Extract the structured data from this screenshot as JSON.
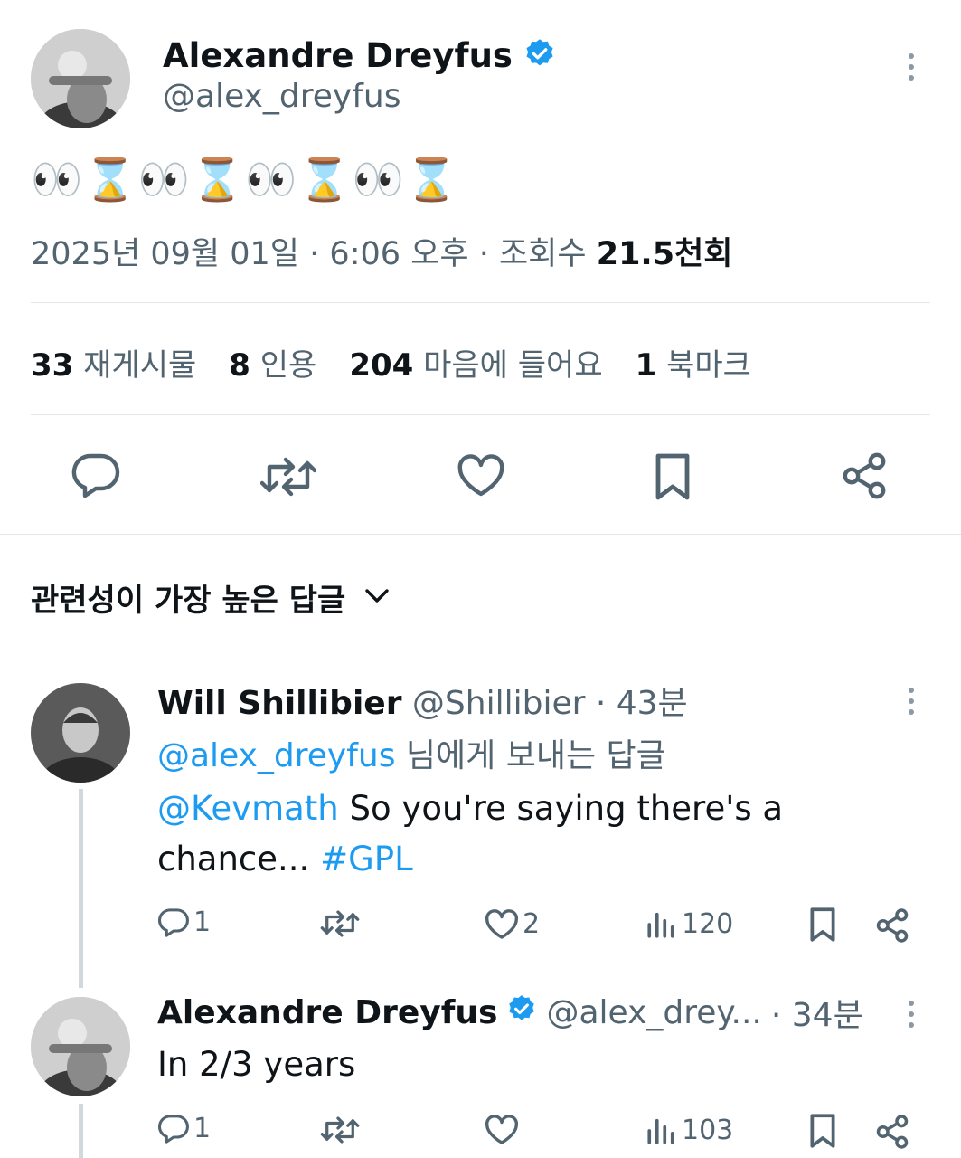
{
  "main_tweet": {
    "author_name": "Alexandre Dreyfus",
    "author_handle": "@alex_dreyfus",
    "text": "👀⌛👀⌛👀⌛👀⌛",
    "date": "2025년 09월 01일",
    "separator1": "·",
    "time": "6:06 오후",
    "separator2": "·",
    "views_label": "조회수",
    "views": "21.5천회"
  },
  "stats": [
    {
      "count": "33",
      "label": "재게시물"
    },
    {
      "count": "8",
      "label": "인용"
    },
    {
      "count": "204",
      "label": "마음에 들어요"
    },
    {
      "count": "1",
      "label": "북마크"
    }
  ],
  "replies_sort": {
    "label": "관련성이 가장 높은 답글"
  },
  "replies": [
    {
      "author_name": "Will Shillibier",
      "author_handle": "@Shillibier",
      "time": "· 43분",
      "replying_to_handle": "@alex_dreyfus",
      "replying_to_suffix": "님에게 보내는 답글",
      "mention": "@Kevmath",
      "text1": "So you're saying there's a",
      "text2": "chance...",
      "hashtag": "#GPL",
      "reply_count": "1",
      "like_count": "2",
      "view_count": "120"
    },
    {
      "author_name": "Alexandre Dreyfus",
      "author_handle": "@alex_drey...",
      "time": "· 34분",
      "text": "In 2/3 years",
      "reply_count": "1",
      "view_count": "103"
    }
  ],
  "colors": {
    "accent": "#1d9bf0",
    "secondary_text": "#536471",
    "divider": "#e1e8ed"
  }
}
